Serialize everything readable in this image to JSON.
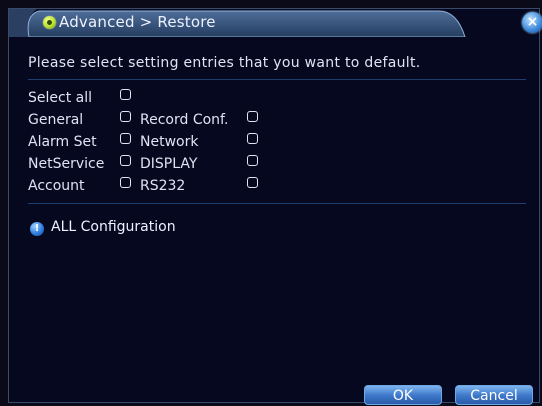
{
  "window": {
    "title": "Advanced > Restore",
    "close_glyph": "×"
  },
  "prompt": "Please select setting entries that you want to default.",
  "select_all": {
    "label": "Select all",
    "checked": false
  },
  "options_left": [
    {
      "label": "General",
      "checked": false
    },
    {
      "label": "Alarm Set",
      "checked": false
    },
    {
      "label": "NetService",
      "checked": false
    },
    {
      "label": "Account",
      "checked": false
    }
  ],
  "options_right": [
    {
      "label": "Record Conf.",
      "checked": false
    },
    {
      "label": "Network",
      "checked": false
    },
    {
      "label": "DISPLAY",
      "checked": false
    },
    {
      "label": "RS232",
      "checked": false
    }
  ],
  "info": {
    "icon": "info-icon",
    "text": "ALL Configuration",
    "icon_glyph": "!"
  },
  "buttons": {
    "ok": "OK",
    "cancel": "Cancel"
  },
  "colors": {
    "background": "#06081f",
    "title_bar": "#2f4b74",
    "accent_button": "#3b76c8",
    "text": "#dfe4f3"
  }
}
